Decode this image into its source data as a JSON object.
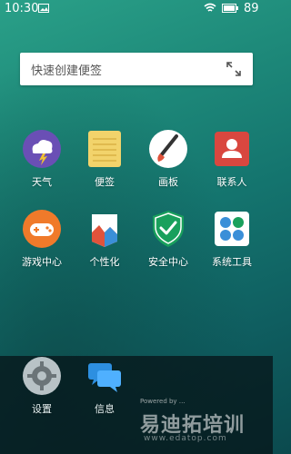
{
  "status_bar": {
    "time": "10:30",
    "battery": "89"
  },
  "search_widget": {
    "placeholder": "快速创建便签"
  },
  "apps_row1": [
    {
      "label": "天气",
      "icon": "weather-icon"
    },
    {
      "label": "便签",
      "icon": "notes-icon"
    },
    {
      "label": "画板",
      "icon": "paint-icon"
    },
    {
      "label": "联系人",
      "icon": "contacts-icon"
    }
  ],
  "apps_row2": [
    {
      "label": "游戏中心",
      "icon": "game-center-icon"
    },
    {
      "label": "个性化",
      "icon": "personalize-icon"
    },
    {
      "label": "安全中心",
      "icon": "security-icon"
    },
    {
      "label": "系统工具",
      "icon": "system-tools-icon"
    }
  ],
  "dock": [
    {
      "label": "设置",
      "icon": "settings-icon"
    },
    {
      "label": "信息",
      "icon": "messages-icon"
    }
  ],
  "watermark": {
    "sub": "Powered by …",
    "title": "易迪拓培训",
    "url": "www.edatop.com"
  },
  "colors": {
    "weather": "#6a4fb5",
    "notes": "#f2d36b",
    "paint": "#ffffff",
    "contacts": "#d9473f",
    "game": "#f07a2a",
    "security": "#19a05c",
    "tools": "#ffffff"
  }
}
